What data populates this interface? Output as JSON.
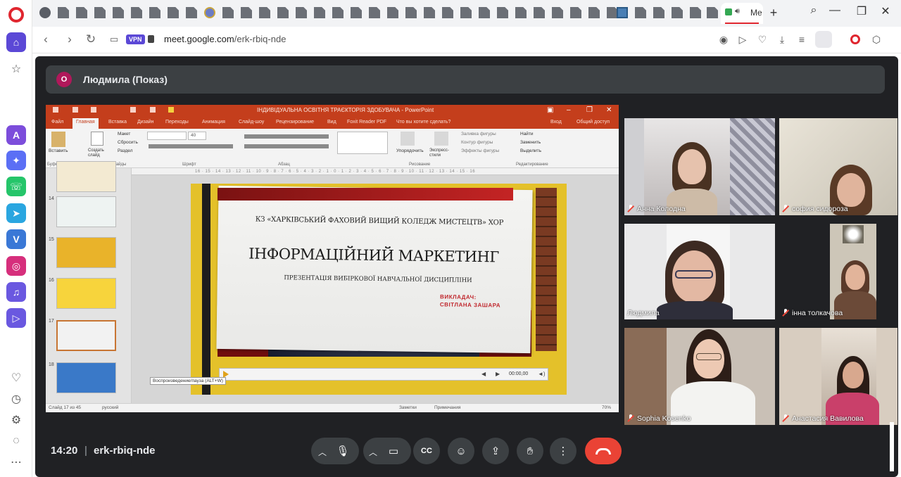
{
  "browser": {
    "active_tab_title": "Me",
    "url_domain": "meet.google.com",
    "url_path": "/erk-rbiq-nde",
    "vpn_label": "VPN"
  },
  "meet": {
    "presenter_initial": "О",
    "presenter_label": "Людмила (Показ)",
    "clock": "14:20",
    "separator": "|",
    "meeting_code": "erk-rbiq-nde"
  },
  "powerpoint": {
    "window_title": "ІНДИВІДУАЛЬНА ОСВІТНЯ ТРАЄКТОРІЯ ЗДОБУВАЧА - PowerPoint",
    "menu": [
      "Файл",
      "Главная",
      "Вставка",
      "Дизайн",
      "Переходы",
      "Анимация",
      "Слайд-шоу",
      "Рецензирование",
      "Вид",
      "Foxit Reader PDF",
      "Что вы хотите сделать?",
      "Вход",
      "Общий доступ"
    ],
    "ribbon": {
      "paste": "Вставить",
      "new_slide": "Создать слайд",
      "layout": "Макет",
      "reset": "Сбросить",
      "section": "Раздел",
      "font_size": "40",
      "arrange": "Упорядочить",
      "quick_styles": "Экспресс-стили",
      "shape_fill": "Заливка фигуры",
      "shape_outline": "Контур фигуры",
      "shape_effects": "Эффекты фигуры",
      "find": "Найти",
      "replace": "Заменить",
      "select": "Выделить",
      "groups": [
        "Буфер обмена",
        "Слайды",
        "Шрифт",
        "Абзац",
        "Рисование",
        "Редактирование"
      ]
    },
    "ruler": "16 · 15 · 14 · 13 · 12 · 11 · 10 · 9 · 8 · 7 · 6 · 5 · 4 · 3 · 2 · 1 · 0 · 1 · 2 · 3 · 4 · 5 · 6 · 7 · 8 · 9 · 10 · 11 · 12 · 13 · 14 · 15 · 16",
    "thumb_numbers": [
      "14",
      "15",
      "16",
      "17",
      "18"
    ],
    "slide": {
      "line1": "КЗ «ХАРКІВСЬКИЙ ФАХОВИЙ ВИЩИЙ КОЛЕДЖ МИСТЕЦТВ» ХОР",
      "title": "ІНФОРМАЦІЙНИЙ МАРКЕТИНГ",
      "subtitle": "ПРЕЗЕНТАЦІЯ ВИБІРКОВОЇ НАВЧАЛЬНОЇ ДИСЦИПЛІНИ",
      "teacher_label": "ВИКЛАДАЧ:",
      "teacher_name": "СВІТЛАНА ЗАШАРА",
      "media_time": "00:00,00",
      "media_tooltip": "Воспроизведение/пауза (ALT+W)"
    },
    "status": {
      "slide_counter": "Слайд 17 из 45",
      "language": "русский",
      "notes": "Заметки",
      "comments": "Примечания",
      "zoom": "70%"
    }
  },
  "participants": [
    {
      "name": "Анна Колодна",
      "muted": true
    },
    {
      "name": "софия сидороза",
      "muted": true
    },
    {
      "name": "Людмила",
      "muted": false
    },
    {
      "name": "інна толкачова",
      "muted": true
    },
    {
      "name": "Sophia Kosenko",
      "muted": true
    },
    {
      "name": "Анастасия Вавилова",
      "muted": true
    }
  ],
  "colors": {
    "meet_bg": "#202124",
    "hangup": "#ea4335",
    "ppt_accent": "#c43e1c",
    "slide_frame": "#e4c12a"
  }
}
